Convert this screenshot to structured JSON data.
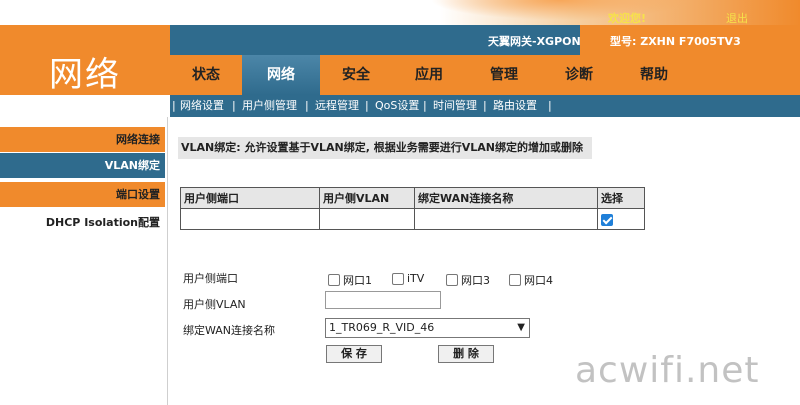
{
  "header": {
    "welcome": "欢迎您!",
    "logout": "退出",
    "brand": "网络",
    "gateway": "天翼网关-XGPON",
    "model": "型号: ZXHN F7005TV3"
  },
  "nav": {
    "tabs": [
      {
        "label": "状态"
      },
      {
        "label": "网络",
        "active": true
      },
      {
        "label": "安全"
      },
      {
        "label": "应用"
      },
      {
        "label": "管理"
      },
      {
        "label": "诊断"
      },
      {
        "label": "帮助"
      }
    ]
  },
  "subnav": {
    "items": [
      "网络设置",
      "用户侧管理",
      "远程管理",
      "QoS设置",
      "时间管理",
      "路由设置"
    ]
  },
  "sidebar": {
    "items": [
      {
        "label": "网络连接"
      },
      {
        "label": "VLAN绑定",
        "active": true
      },
      {
        "label": "端口设置"
      },
      {
        "label": "DHCP Isolation配置"
      }
    ]
  },
  "main": {
    "description": "VLAN绑定: 允许设置基于VLAN绑定, 根据业务需要进行VLAN绑定的增加或删除",
    "table": {
      "headers": [
        "用户侧端口",
        "用户侧VLAN",
        "绑定WAN连接名称",
        "选择"
      ],
      "rows": [
        {
          "port": "",
          "vlan": "",
          "wan": "",
          "selected": true
        }
      ]
    },
    "form": {
      "port_label": "用户侧端口",
      "port_options": [
        "网口1",
        "iTV",
        "网口3",
        "网口4"
      ],
      "vlan_label": "用户侧VLAN",
      "vlan_value": "",
      "wan_label": "绑定WAN连接名称",
      "wan_selected": "1_TR069_R_VID_46",
      "save_label": "保 存",
      "delete_label": "删 除"
    }
  },
  "watermark": "acwifi.net",
  "colors": {
    "orange": "#f08a2c",
    "blue": "#2f6b8d",
    "checkbox": "#1f7fd8"
  }
}
